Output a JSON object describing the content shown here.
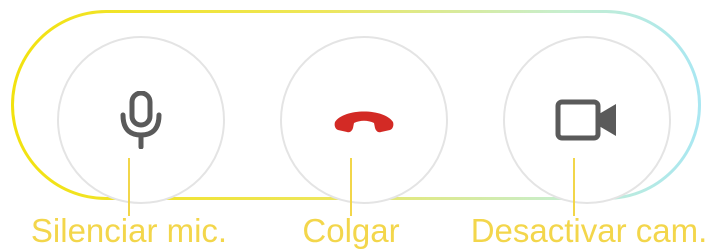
{
  "controls": {
    "mute": {
      "icon": "microphone-icon",
      "label": "Silenciar mic."
    },
    "hangup": {
      "icon": "phone-hangup-icon",
      "label": "Colgar",
      "icon_color": "#d32a25"
    },
    "camera": {
      "icon": "video-camera-icon",
      "label": "Desactivar cam."
    }
  },
  "colors": {
    "icon_gray": "#5a5a5a",
    "label_yellow": "#f3d64b",
    "button_border": "#e4e4e4",
    "outline_gradient": [
      "#f2e20e",
      "#a9e7f2"
    ]
  }
}
